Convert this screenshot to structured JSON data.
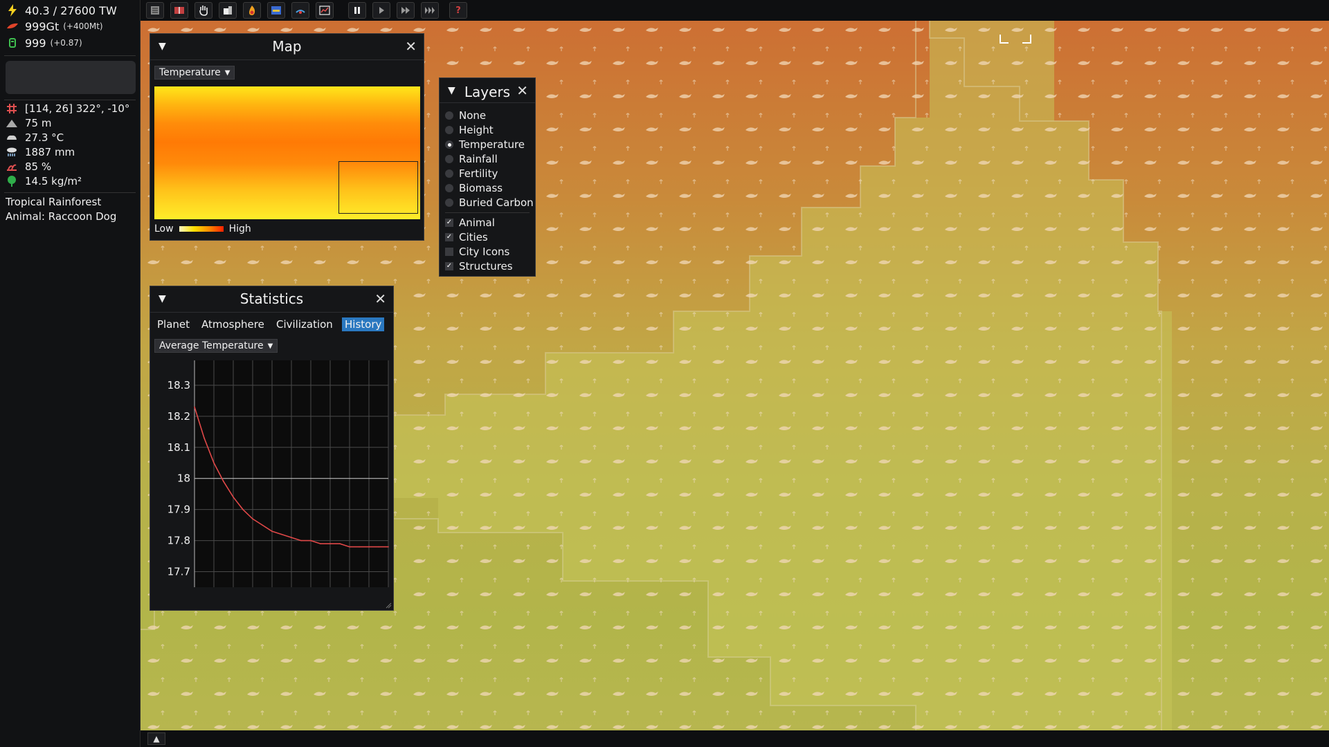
{
  "resources": {
    "energy": "40.3 / 27600 TW",
    "carbon": "999Gt",
    "carbon_delta": "(+400Mt)",
    "population": "999",
    "population_delta": "(+0.87)"
  },
  "tile": {
    "coords": "[114, 26]  322°, -10°",
    "height": "75 m",
    "temperature": "27.3 °C",
    "rainfall": "1887 mm",
    "fertility": "85 %",
    "biomass": "14.5 kg/m²",
    "biome": "Tropical Rainforest",
    "animal": "Animal: Raccoon Dog"
  },
  "toolbar": {
    "buttons": [
      "menu-icon",
      "encyclopedia-icon",
      "hand-icon",
      "build-icon",
      "fire-icon",
      "map-view-icon",
      "terraform-icon",
      "graph-icon"
    ],
    "speed": [
      "pause-icon",
      "play-icon",
      "fast-icon",
      "fastest-icon"
    ],
    "help": "?"
  },
  "map_window": {
    "title": "Map",
    "dropdown": "Temperature",
    "legend_low": "Low",
    "legend_high": "High"
  },
  "layers_window": {
    "title": "Layers",
    "radios": [
      {
        "label": "None",
        "selected": false
      },
      {
        "label": "Height",
        "selected": false
      },
      {
        "label": "Temperature",
        "selected": true
      },
      {
        "label": "Rainfall",
        "selected": false
      },
      {
        "label": "Fertility",
        "selected": false
      },
      {
        "label": "Biomass",
        "selected": false
      },
      {
        "label": "Buried Carbon",
        "selected": false
      }
    ],
    "checks": [
      {
        "label": "Animal",
        "checked": true
      },
      {
        "label": "Cities",
        "checked": true
      },
      {
        "label": "City Icons",
        "checked": false
      },
      {
        "label": "Structures",
        "checked": true
      }
    ]
  },
  "stats_window": {
    "title": "Statistics",
    "tabs": [
      "Planet",
      "Atmosphere",
      "Civilization",
      "History"
    ],
    "active_tab": "History",
    "dropdown": "Average Temperature"
  },
  "chart_data": {
    "type": "line",
    "title": "",
    "xlabel": "",
    "ylabel": "",
    "ylim": [
      17.65,
      18.38
    ],
    "yticks": [
      "18.3",
      "18.2",
      "18.1",
      "18",
      "17.9",
      "17.8",
      "17.7"
    ],
    "ytick_values": [
      18.3,
      18.2,
      18.1,
      18.0,
      17.9,
      17.8,
      17.7
    ],
    "series": [
      {
        "color": "#e04848",
        "x": [
          0,
          5,
          10,
          15,
          20,
          25,
          30,
          35,
          40,
          45,
          50,
          55,
          60,
          65,
          70,
          75,
          80,
          85,
          90,
          95,
          100
        ],
        "values": [
          18.23,
          18.13,
          18.05,
          17.99,
          17.94,
          17.9,
          17.87,
          17.85,
          17.83,
          17.82,
          17.81,
          17.8,
          17.8,
          17.79,
          17.79,
          17.79,
          17.78,
          17.78,
          17.78,
          17.78,
          17.78
        ]
      }
    ]
  },
  "bottom_bar": {
    "expand": "▲"
  }
}
